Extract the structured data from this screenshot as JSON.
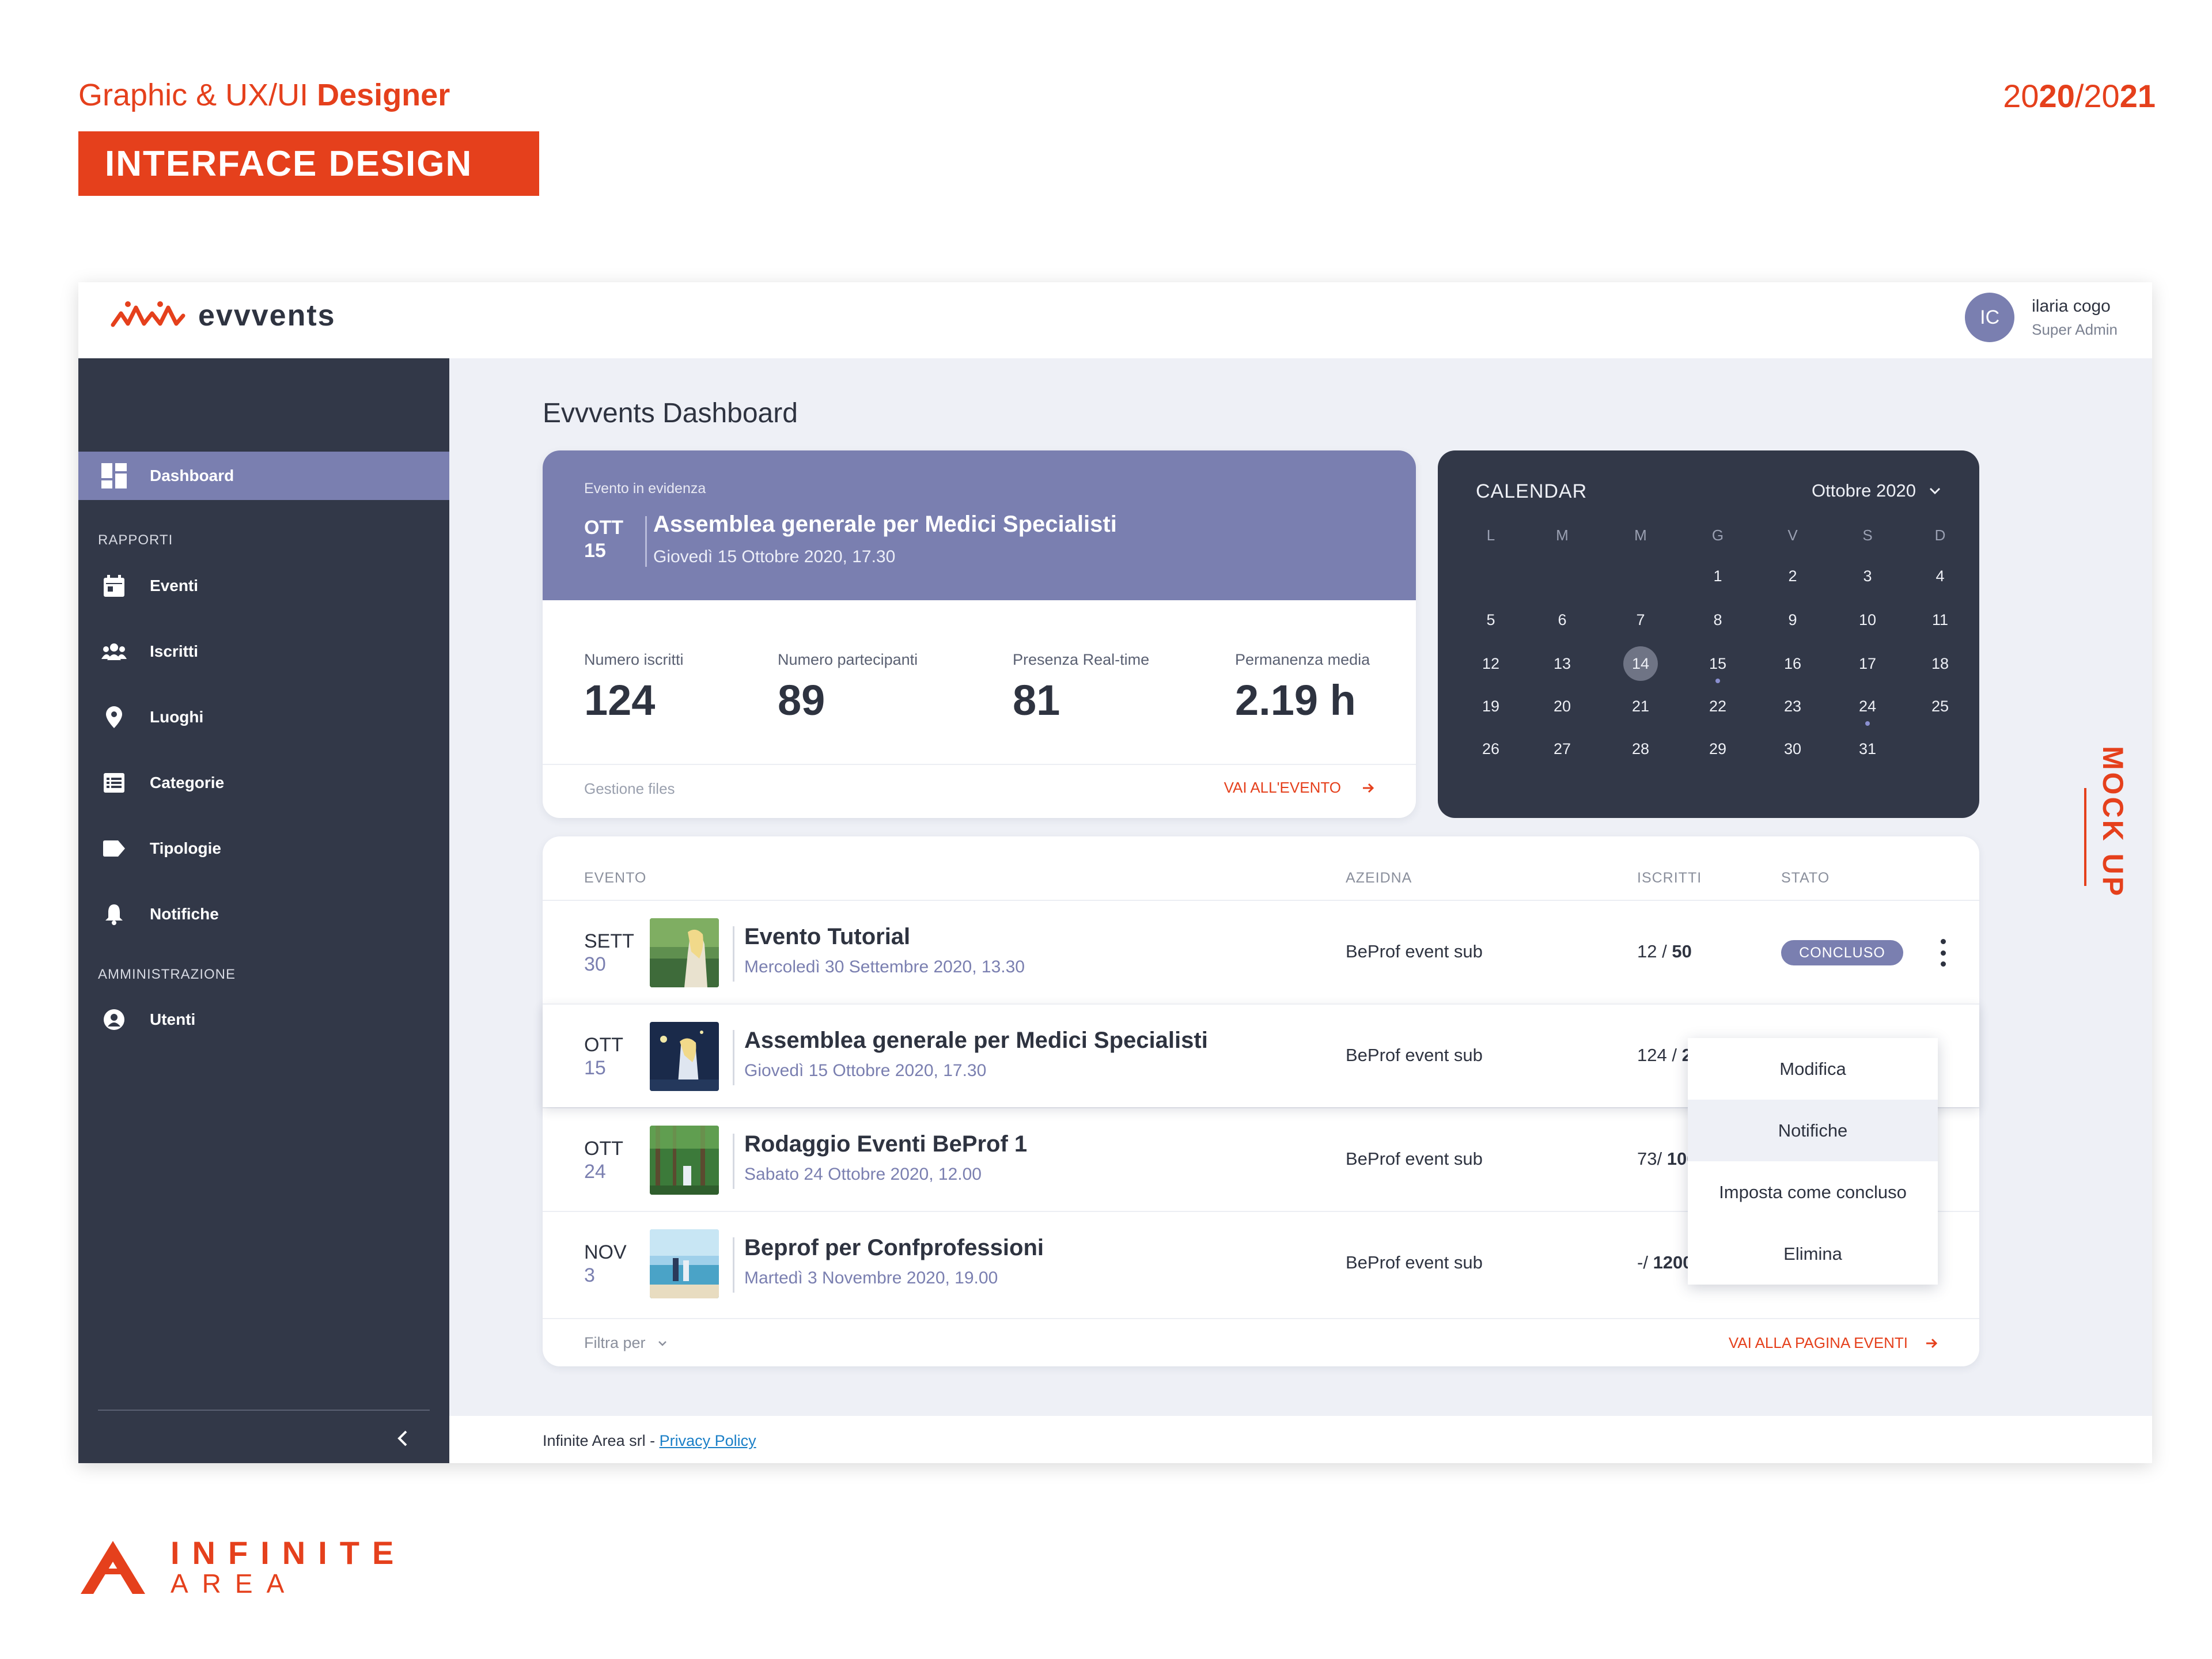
{
  "portfolio": {
    "role_prefix": "Graphic & UX/UI ",
    "role_strong": "Designer",
    "banner": "INTERFACE DESIGN",
    "year_a": "20",
    "year_a_strong": "20",
    "year_sep": "/",
    "year_b": "20",
    "year_b_strong": "21",
    "mockup_label": "MOCK UP",
    "company_logo_line1": "INFINITE",
    "company_logo_line2": "AREA"
  },
  "app": {
    "brand": "evvvents",
    "user": {
      "initials": "IC",
      "name": "ilaria cogo",
      "role": "Super Admin"
    },
    "page_title": "Evvvents Dashboard"
  },
  "sidebar": {
    "dashboard": "Dashboard",
    "group_reports": "RAPPORTI",
    "items": [
      {
        "label": "Eventi",
        "icon": "calendar-icon"
      },
      {
        "label": "Iscritti",
        "icon": "people-icon"
      },
      {
        "label": "Luoghi",
        "icon": "pin-icon"
      },
      {
        "label": "Categorie",
        "icon": "list-icon"
      },
      {
        "label": "Tipologie",
        "icon": "tag-icon"
      },
      {
        "label": "Notifiche",
        "icon": "bell-icon"
      }
    ],
    "group_admin": "AMMINISTRAZIONE",
    "users": "Utenti"
  },
  "featured": {
    "label": "Evento in evidenza",
    "month": "OTT",
    "day": "15",
    "name": "Assemblea generale per Medici Specialisti",
    "when": "Giovedì 15 Ottobre 2020, 17.30",
    "stats": [
      {
        "label": "Numero iscritti",
        "value": "124"
      },
      {
        "label": "Numero partecipanti",
        "value": "89"
      },
      {
        "label": "Presenza Real-time",
        "value": "81"
      },
      {
        "label": "Permanenza media",
        "value": "2.19 h"
      }
    ],
    "files": "Gestione files",
    "cta": "VAI ALL'EVENTO"
  },
  "calendar": {
    "title": "CALENDAR",
    "month": "Ottobre 2020",
    "weekdays": [
      "L",
      "M",
      "M",
      "G",
      "V",
      "S",
      "D"
    ],
    "days": [
      "1",
      "2",
      "3",
      "4",
      "5",
      "6",
      "7",
      "8",
      "9",
      "10",
      "11",
      "12",
      "13",
      "14",
      "15",
      "16",
      "17",
      "18",
      "19",
      "20",
      "21",
      "22",
      "23",
      "24",
      "25",
      "26",
      "27",
      "28",
      "29",
      "30",
      "31"
    ],
    "today": "14",
    "event_days": [
      "15",
      "24"
    ]
  },
  "events_table": {
    "headers": {
      "event": "EVENTO",
      "company": "AZEIDNA",
      "registered": "ISCRITTI",
      "status": "STATO"
    },
    "rows": [
      {
        "month": "SETT",
        "day": "30",
        "name": "Evento Tutorial",
        "when": "Mercoledì 30 Settembre 2020, 13.30",
        "company": "BeProf event sub",
        "reg_count": "12 / ",
        "reg_max": "50",
        "status": "CONCLUSO"
      },
      {
        "month": "OTT",
        "day": "15",
        "name": "Assemblea generale per Medici Specialisti",
        "when": "Giovedì 15 Ottobre 2020, 17.30",
        "company": "BeProf event sub",
        "reg_count": "124 / ",
        "reg_max": "200",
        "status": ""
      },
      {
        "month": "OTT",
        "day": "24",
        "name": "Rodaggio Eventi BeProf 1",
        "when": "Sabato 24 Ottobre 2020, 12.00",
        "company": "BeProf event sub",
        "reg_count": "73/ ",
        "reg_max": "100",
        "status": ""
      },
      {
        "month": "NOV",
        "day": "3",
        "name": "Beprof per Confprofessioni",
        "when": "Martedì 3 Novembre 2020, 19.00",
        "company": "BeProf event sub",
        "reg_count": "-/ ",
        "reg_max": "1200",
        "status": ""
      }
    ],
    "filter": "Filtra per",
    "cta": "VAI ALLA PAGINA EVENTI",
    "context_menu": [
      "Modifica",
      "Notifiche",
      "Imposta come concluso",
      "Elimina"
    ]
  },
  "footer": {
    "text": "Infinite Area srl - ",
    "link": "Privacy Policy"
  },
  "colors": {
    "accent": "#e5401c",
    "primary": "#7a7fb0",
    "dark": "#323848",
    "background": "#eef0f6"
  }
}
